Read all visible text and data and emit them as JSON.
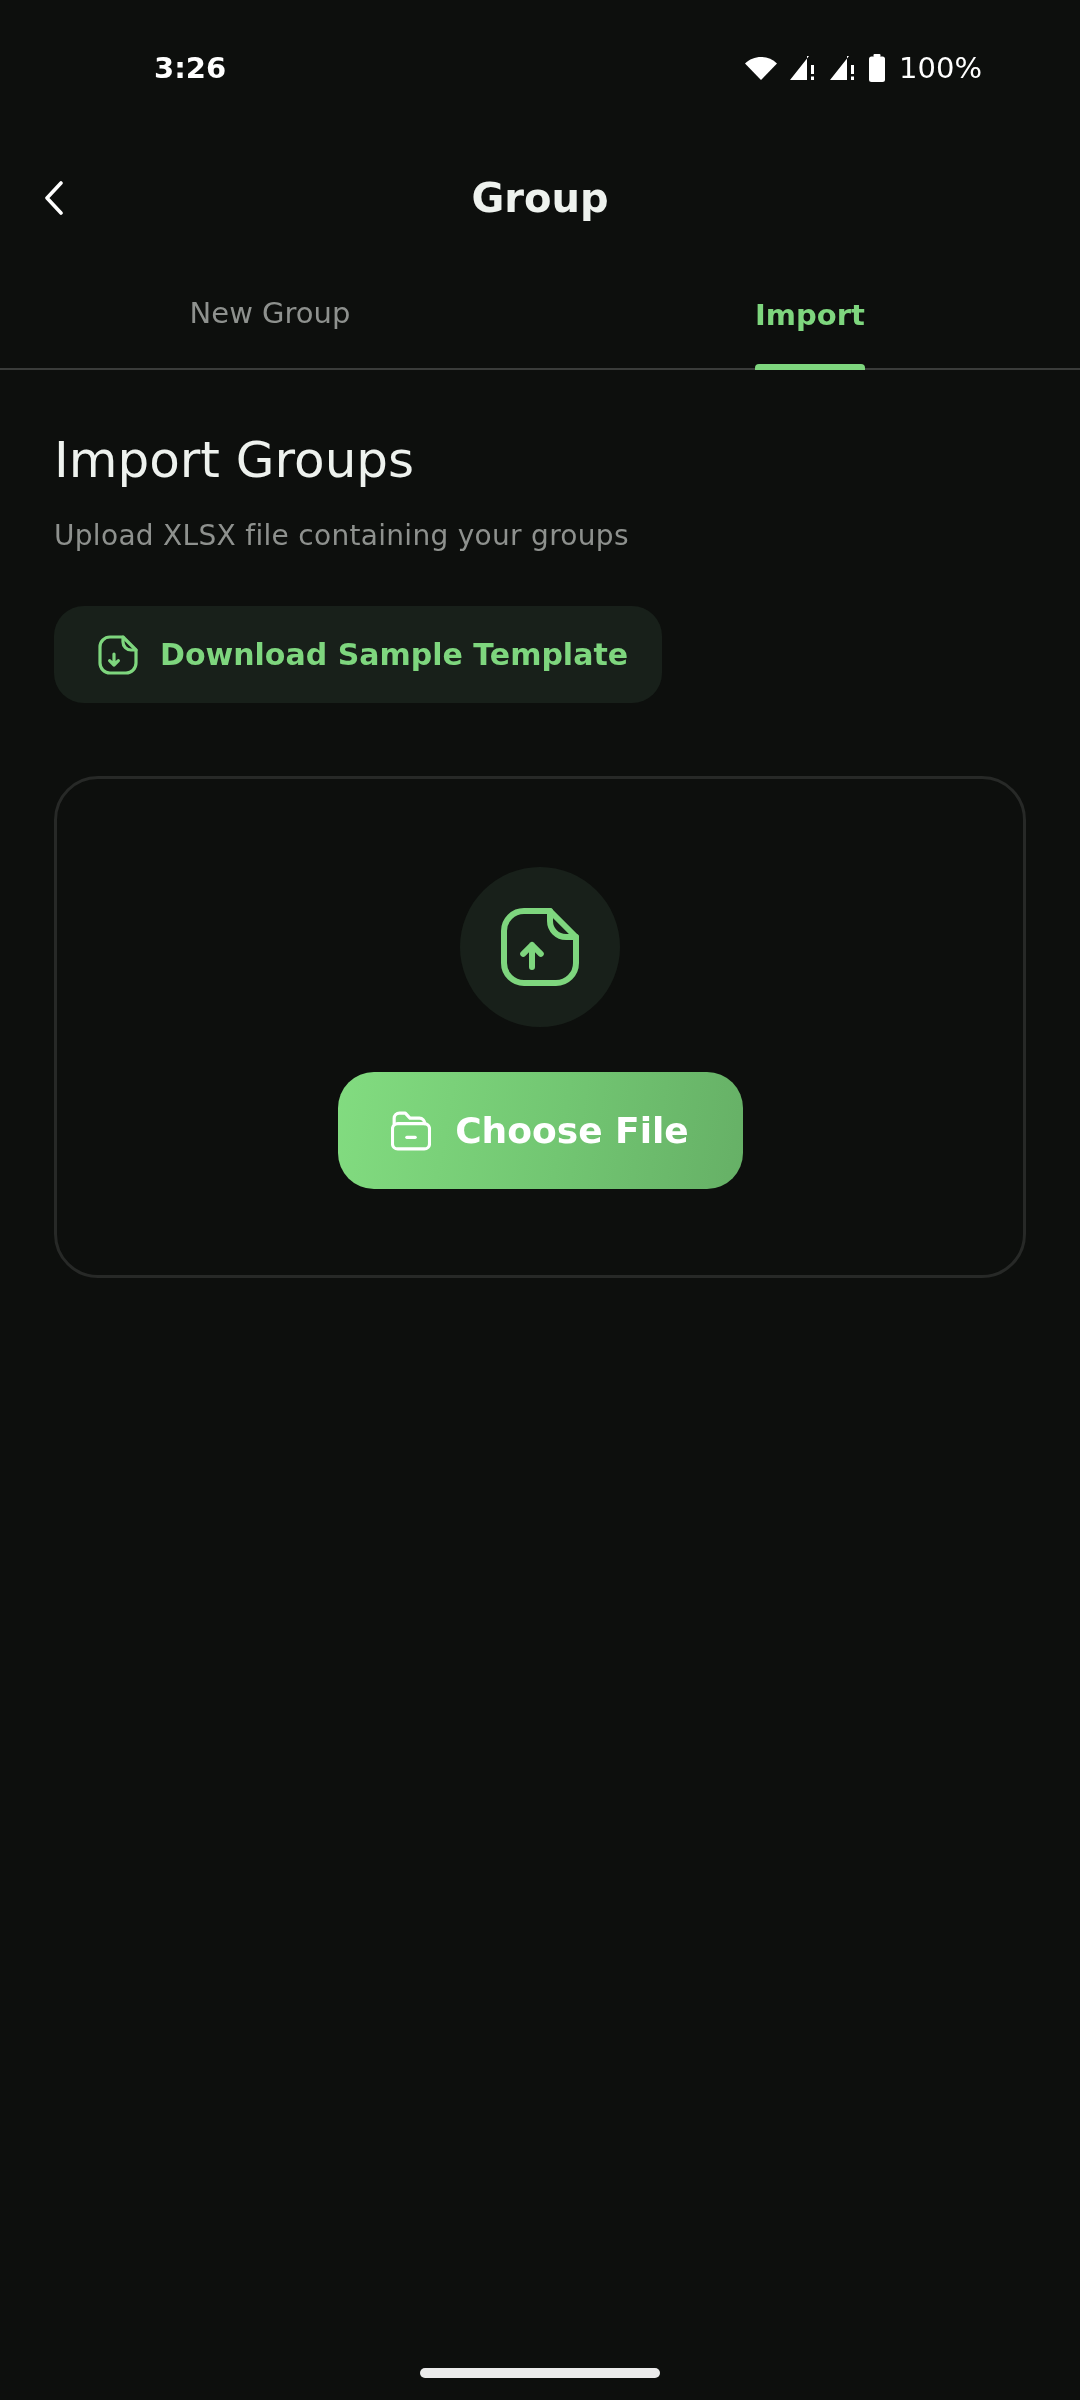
{
  "status_bar": {
    "time": "3:26",
    "battery": "100%"
  },
  "header": {
    "title": "Group"
  },
  "tabs": [
    {
      "label": "New Group",
      "selected": false
    },
    {
      "label": "Import",
      "selected": true
    }
  ],
  "import": {
    "title": "Import Groups",
    "subtitle": "Upload XLSX file containing your groups",
    "download_button": "Download Sample Template",
    "upload_card": {
      "button": "Choose File"
    }
  }
}
